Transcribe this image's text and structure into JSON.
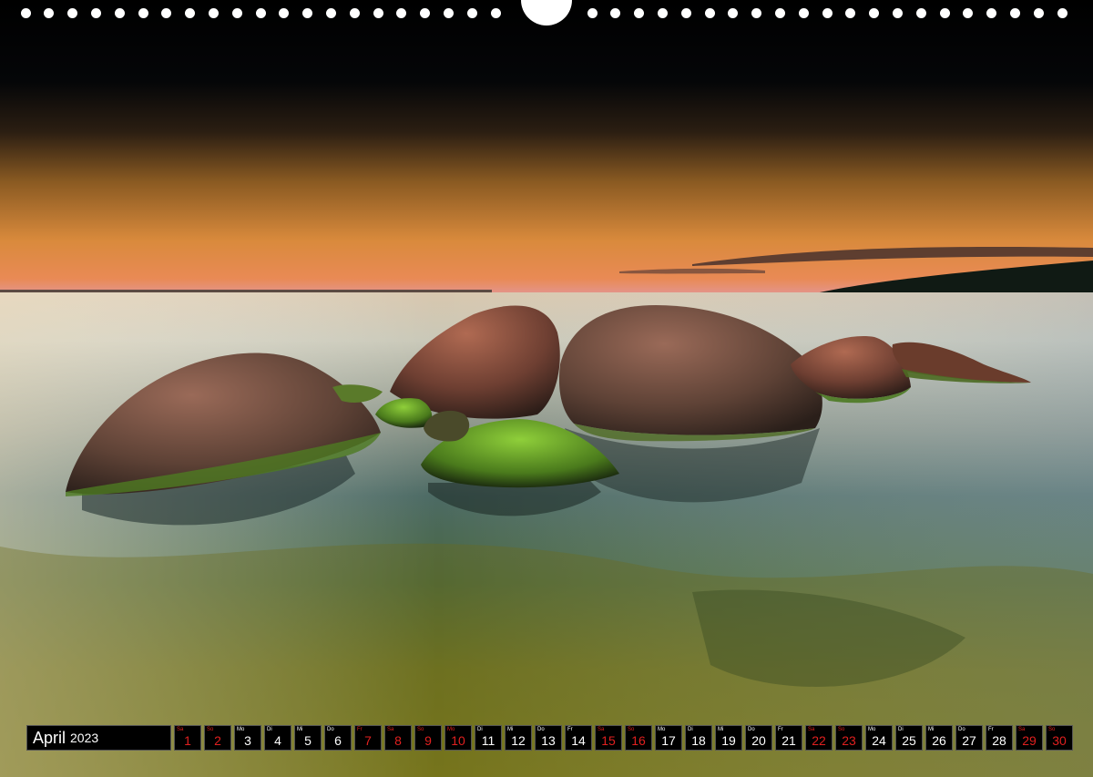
{
  "calendar": {
    "month": "April",
    "year": "2023",
    "days": [
      {
        "wd": "Sa",
        "num": "1",
        "weekend": true
      },
      {
        "wd": "So",
        "num": "2",
        "weekend": true
      },
      {
        "wd": "Mo",
        "num": "3",
        "weekend": false
      },
      {
        "wd": "Di",
        "num": "4",
        "weekend": false
      },
      {
        "wd": "Mi",
        "num": "5",
        "weekend": false
      },
      {
        "wd": "Do",
        "num": "6",
        "weekend": false
      },
      {
        "wd": "Fr",
        "num": "7",
        "weekend": true
      },
      {
        "wd": "Sa",
        "num": "8",
        "weekend": true
      },
      {
        "wd": "So",
        "num": "9",
        "weekend": true
      },
      {
        "wd": "Mo",
        "num": "10",
        "weekend": true
      },
      {
        "wd": "Di",
        "num": "11",
        "weekend": false
      },
      {
        "wd": "Mi",
        "num": "12",
        "weekend": false
      },
      {
        "wd": "Do",
        "num": "13",
        "weekend": false
      },
      {
        "wd": "Fr",
        "num": "14",
        "weekend": false
      },
      {
        "wd": "Sa",
        "num": "15",
        "weekend": true
      },
      {
        "wd": "So",
        "num": "16",
        "weekend": true
      },
      {
        "wd": "Mo",
        "num": "17",
        "weekend": false
      },
      {
        "wd": "Di",
        "num": "18",
        "weekend": false
      },
      {
        "wd": "Mi",
        "num": "19",
        "weekend": false
      },
      {
        "wd": "Do",
        "num": "20",
        "weekend": false
      },
      {
        "wd": "Fr",
        "num": "21",
        "weekend": false
      },
      {
        "wd": "Sa",
        "num": "22",
        "weekend": true
      },
      {
        "wd": "So",
        "num": "23",
        "weekend": true
      },
      {
        "wd": "Mo",
        "num": "24",
        "weekend": false
      },
      {
        "wd": "Di",
        "num": "25",
        "weekend": false
      },
      {
        "wd": "Mi",
        "num": "26",
        "weekend": false
      },
      {
        "wd": "Do",
        "num": "27",
        "weekend": false
      },
      {
        "wd": "Fr",
        "num": "28",
        "weekend": false
      },
      {
        "wd": "Sa",
        "num": "29",
        "weekend": true
      },
      {
        "wd": "So",
        "num": "30",
        "weekend": true
      }
    ]
  },
  "colors": {
    "weekend": "#e0201f",
    "weekday": "#ffffff",
    "cell_background": "#000000"
  }
}
